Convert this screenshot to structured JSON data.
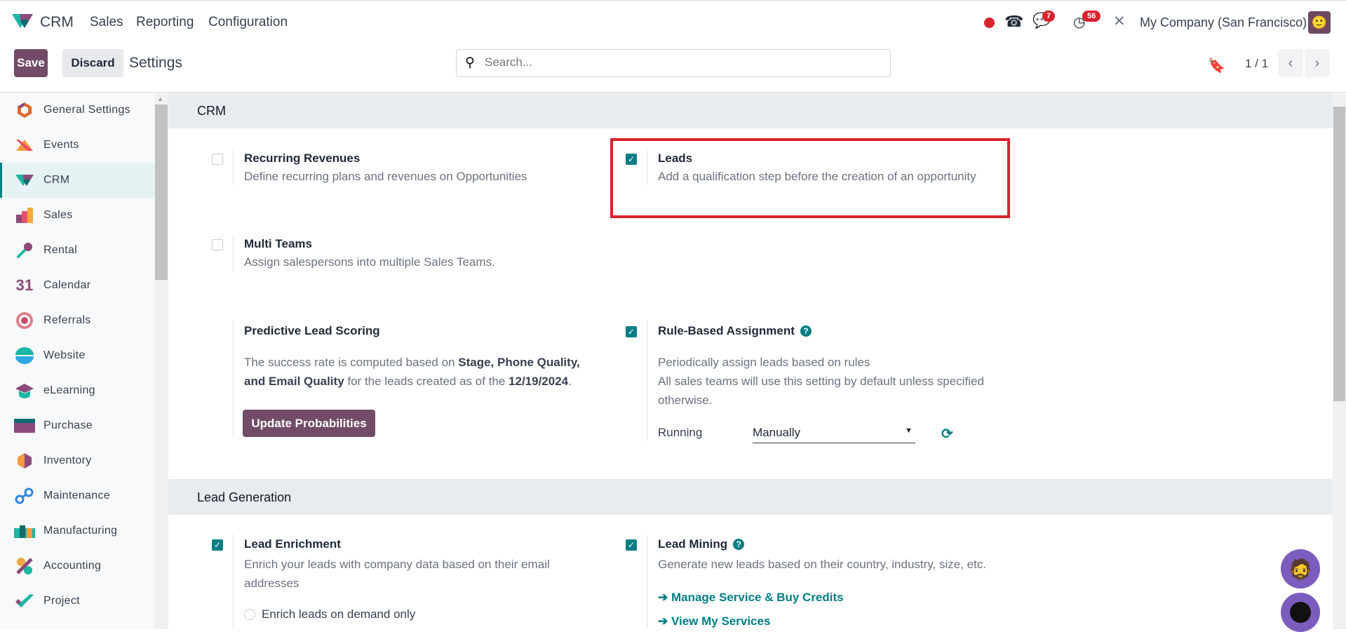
{
  "nav": {
    "app": "CRM",
    "menus": [
      "Sales",
      "Reporting",
      "Configuration"
    ],
    "messages_badge": "7",
    "activities_badge": "56",
    "company": "My Company (San Francisco)"
  },
  "control": {
    "save": "Save",
    "discard": "Discard",
    "title": "Settings",
    "search_placeholder": "Search...",
    "pager": "1 / 1"
  },
  "sidebar": {
    "items": [
      "General Settings",
      "Events",
      "CRM",
      "Sales",
      "Rental",
      "Calendar",
      "Referrals",
      "Website",
      "eLearning",
      "Purchase",
      "Inventory",
      "Maintenance",
      "Manufacturing",
      "Accounting",
      "Project"
    ],
    "active": "CRM",
    "calendar_icon_text": "31"
  },
  "crm": {
    "heading": "CRM",
    "recurring": {
      "label": "Recurring Revenues",
      "desc": "Define recurring plans and revenues on Opportunities",
      "checked": false
    },
    "leads": {
      "label": "Leads",
      "desc": "Add a qualification step before the creation of an opportunity",
      "checked": true
    },
    "multi_teams": {
      "label": "Multi Teams",
      "desc": "Assign salespersons into multiple Sales Teams.",
      "checked": false
    },
    "pls": {
      "label": "Predictive Lead Scoring",
      "desc1": "The success rate is computed based on ",
      "b1": "Stage, Phone Quality,",
      "b2": "and Email Quality",
      "desc2": " for the leads created as of the ",
      "b3": "12/19/2024",
      "dot": ".",
      "button": "Update Probabilities"
    },
    "rba": {
      "label": "Rule-Based Assignment",
      "help": "?",
      "desc1": "Periodically assign leads based on rules",
      "desc2": "All sales teams will use this setting by default unless specified",
      "desc3": "otherwise.",
      "running_label": "Running",
      "running_value": "Manually",
      "checked": true
    }
  },
  "leadgen": {
    "heading": "Lead Generation",
    "enrichment": {
      "label": "Lead Enrichment",
      "desc1": "Enrich your leads with company data based on their email",
      "desc2": "addresses",
      "option": "Enrich leads on demand only",
      "checked": true
    },
    "mining": {
      "label": "Lead Mining",
      "help": "?",
      "desc": "Generate new leads based on their country, industry, size, etc.",
      "link1": "➔ Manage Service & Buy Credits",
      "link2": "➔ View My Services",
      "checked": true
    }
  },
  "colors": {
    "primary": "#714b67",
    "accent": "#017e84",
    "highlight": "#d9232d",
    "badge": "#d9232d"
  }
}
